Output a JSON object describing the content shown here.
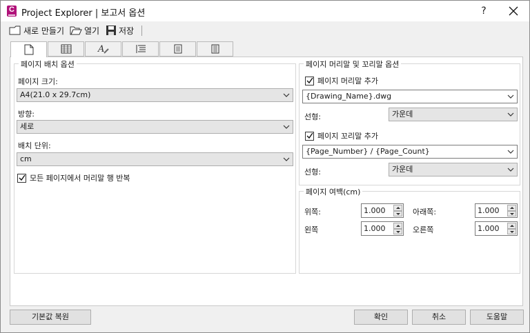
{
  "window": {
    "title": "Project Explorer | 보고서 옵션",
    "app_icon_letter": "C",
    "help_symbol": "?",
    "close_icon": "close-icon"
  },
  "toolbar": {
    "new_label": "새로 만들기",
    "open_label": "열기",
    "save_label": "저장"
  },
  "tabs": [
    {
      "icon": "page-icon",
      "active": true
    },
    {
      "icon": "table-icon",
      "active": false
    },
    {
      "icon": "text-format-icon",
      "active": false
    },
    {
      "icon": "list-icon",
      "active": false
    },
    {
      "icon": "document-icon",
      "active": false
    },
    {
      "icon": "document-lines-icon",
      "active": false
    }
  ],
  "layout_options": {
    "title": "페이지 배치 옵션",
    "page_size_label": "페이지 크기:",
    "page_size_value": "A4(21.0 x 29.7cm)",
    "orientation_label": "방향:",
    "orientation_value": "세로",
    "units_label": "배치 단위:",
    "units_value": "cm",
    "repeat_header_label": "모든 페이지에서 머리말 행 반복",
    "repeat_header_checked": true
  },
  "header_footer": {
    "title": "페이지 머리말 및 꼬리말 옵션",
    "add_header_label": "페이지 머리말 추가",
    "add_header_checked": true,
    "header_value": "{Drawing_Name}.dwg",
    "header_align_label": "선형:",
    "header_align_value": "가운데",
    "add_footer_label": "페이지 꼬리말 추가",
    "add_footer_checked": true,
    "footer_value": "{Page_Number} / {Page_Count}",
    "footer_align_label": "선형:",
    "footer_align_value": "가운데"
  },
  "margins": {
    "title": "페이지 여백(cm)",
    "top_label": "위쪽:",
    "top_value": "1.000",
    "bottom_label": "아래쪽:",
    "bottom_value": "1.000",
    "left_label": "왼쪽",
    "left_value": "1.000",
    "right_label": "오른쪽",
    "right_value": "1.000"
  },
  "buttons": {
    "reset_label": "기본값 복원",
    "ok_label": "확인",
    "cancel_label": "취소",
    "help_label": "도움말"
  },
  "colors": {
    "app_icon": "#b1127a",
    "window_bg": "#f0f0f0",
    "panel_bg": "#ffffff"
  }
}
